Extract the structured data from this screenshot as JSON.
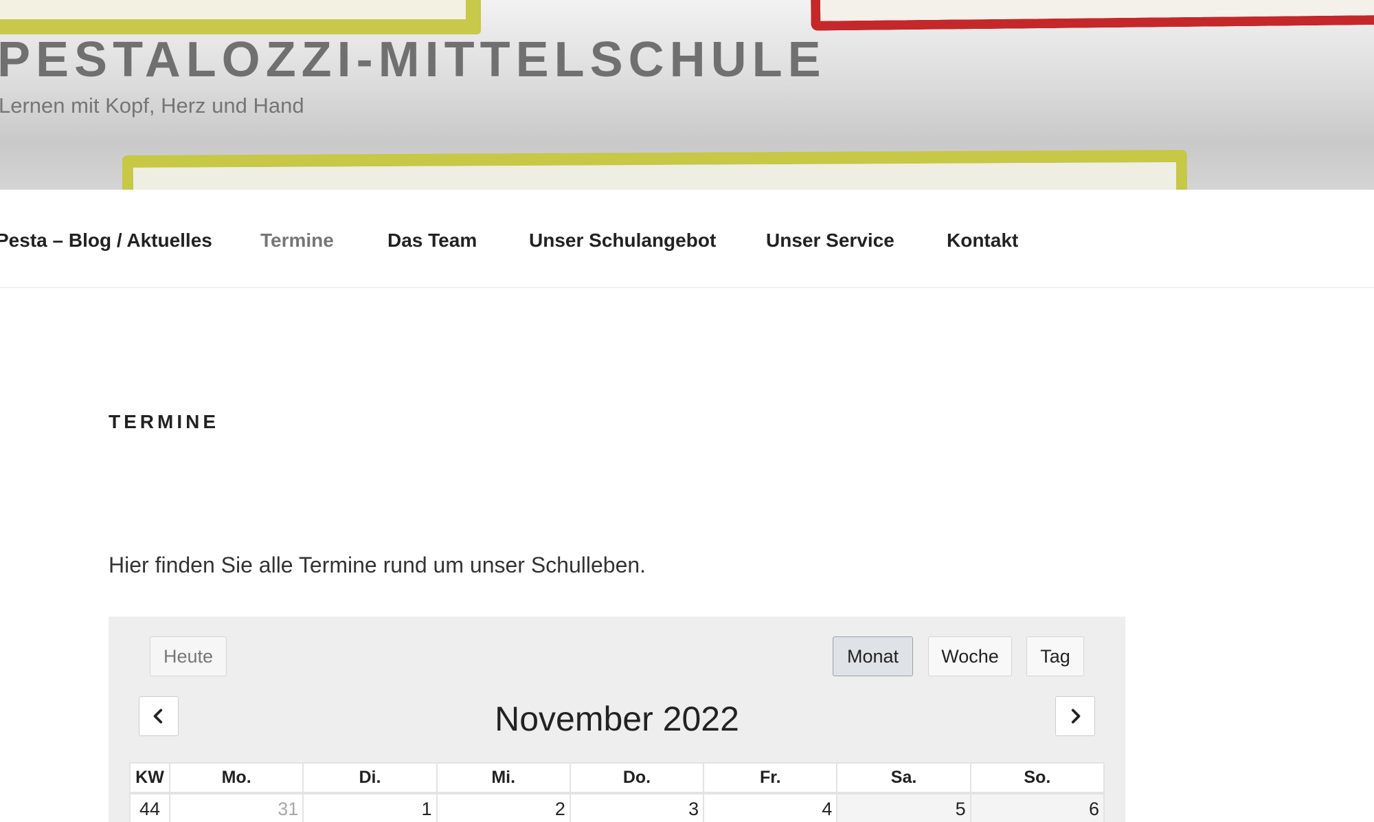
{
  "site": {
    "title": "PESTALOZZI-MITTELSCHULE",
    "tagline": "Lernen mit Kopf, Herz und Hand"
  },
  "nav": {
    "items": [
      {
        "label": "Pesta – Blog / Aktuelles",
        "active": false
      },
      {
        "label": "Termine",
        "active": true
      },
      {
        "label": "Das Team",
        "active": false
      },
      {
        "label": "Unser Schulangebot",
        "active": false
      },
      {
        "label": "Unser Service",
        "active": false
      },
      {
        "label": "Kontakt",
        "active": false
      }
    ]
  },
  "page": {
    "heading": "TERMINE",
    "intro": "Hier finden Sie alle Termine rund um unser Schulleben."
  },
  "calendar": {
    "today_label": "Heute",
    "views": {
      "month": "Monat",
      "week": "Woche",
      "day": "Tag"
    },
    "active_view": "month",
    "title": "November 2022",
    "headers": [
      "KW",
      "Mo.",
      "Di.",
      "Mi.",
      "Do.",
      "Fr.",
      "Sa.",
      "So."
    ],
    "weeks": [
      {
        "kw": "44",
        "days": [
          "31",
          "1",
          "2",
          "3",
          "4",
          "5",
          "6"
        ]
      }
    ]
  },
  "colors": {
    "title_gray": "#707070",
    "active_nav": "#767676",
    "calendar_bg": "#eeeeee",
    "active_view_bg": "#dfe2e6"
  }
}
